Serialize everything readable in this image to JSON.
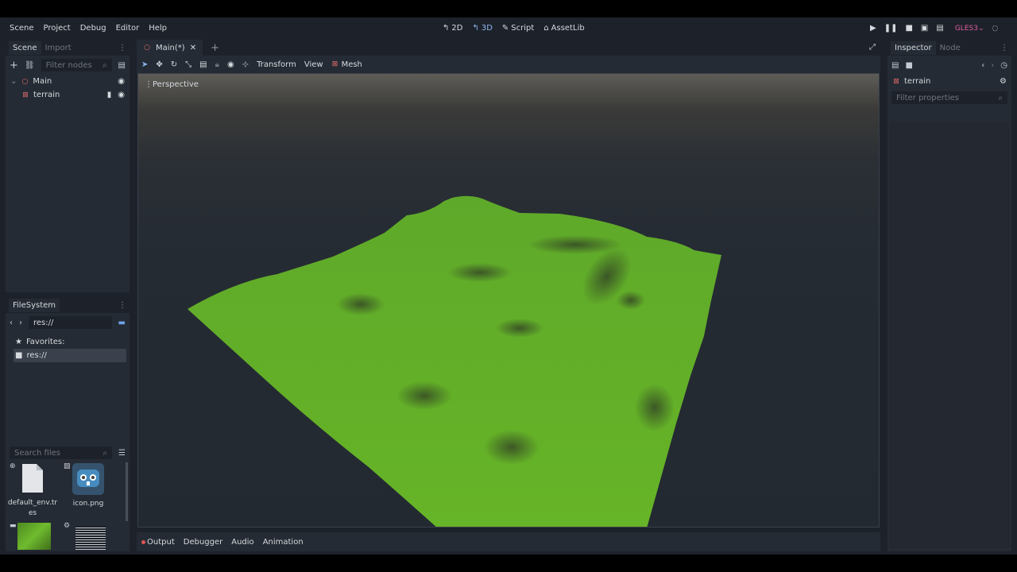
{
  "menu": {
    "scene": "Scene",
    "project": "Project",
    "debug": "Debug",
    "editor": "Editor",
    "help": "Help"
  },
  "modes": {
    "m2d": "2D",
    "m3d": "3D",
    "script": "Script",
    "assetlib": "AssetLib"
  },
  "renderer": "GLES3",
  "scene_dock": {
    "tab_scene": "Scene",
    "tab_import": "Import",
    "filter_placeholder": "Filter nodes",
    "tree": [
      {
        "label": "Main"
      },
      {
        "label": "terrain"
      }
    ]
  },
  "filesystem": {
    "title": "FileSystem",
    "path": "res://",
    "favorites": "Favorites:",
    "res": "res://",
    "search_placeholder": "Search files",
    "files": [
      {
        "name": "default_env.tres"
      },
      {
        "name": "icon.png"
      }
    ]
  },
  "editor_tab": {
    "label": "Main(*)"
  },
  "viewport_toolbar": {
    "transform": "Transform",
    "view": "View",
    "mesh": "Mesh"
  },
  "viewport": {
    "label": "Perspective"
  },
  "bottom_tabs": {
    "output": "Output",
    "debugger": "Debugger",
    "audio": "Audio",
    "animation": "Animation"
  },
  "inspector": {
    "tab_inspector": "Inspector",
    "tab_node": "Node",
    "object": "terrain",
    "filter_placeholder": "Filter properties"
  },
  "colors": {
    "accent": "#8cb4f0",
    "terrain": "#67b22a",
    "node_icon": "#e36b6b",
    "gles": "#e05ca2"
  }
}
